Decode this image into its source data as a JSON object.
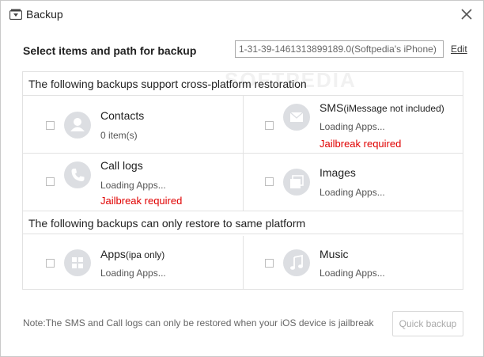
{
  "window": {
    "title": "Backup"
  },
  "header": {
    "label": "Select items and path for backup",
    "path_value": "1-31-39-1461313899189.0(Softpedia's iPhone)",
    "edit_label": "Edit"
  },
  "section_cross": {
    "title": "The following backups support cross-platform restoration",
    "items": [
      {
        "name": "Contacts",
        "note": "",
        "status": "0 item(s)",
        "warning": "",
        "icon": "person-icon"
      },
      {
        "name": "SMS",
        "note": "(iMessage not included)",
        "status": "Loading Apps...",
        "warning": "Jailbreak required",
        "icon": "envelope-icon"
      },
      {
        "name": "Call logs",
        "note": "",
        "status": "Loading Apps...",
        "warning": "Jailbreak required",
        "icon": "phone-icon"
      },
      {
        "name": "Images",
        "note": "",
        "status": "Loading Apps...",
        "warning": "",
        "icon": "images-icon"
      }
    ]
  },
  "section_same": {
    "title": "The following backups can only restore to same platform",
    "items": [
      {
        "name": "Apps",
        "note": "(ipa only)",
        "status": "Loading Apps...",
        "icon": "apps-icon"
      },
      {
        "name": "Music",
        "note": "",
        "status": "Loading Apps...",
        "icon": "music-note-icon"
      }
    ]
  },
  "footer": {
    "note": "Note:The SMS and Call logs can only be restored when your iOS device is jailbreak",
    "quick_backup_label": "Quick backup"
  },
  "watermark": "SOFTPEDIA",
  "colors": {
    "warning": "#e00000",
    "icon_circle": "#dcdee2",
    "border": "#e2e2e2"
  }
}
